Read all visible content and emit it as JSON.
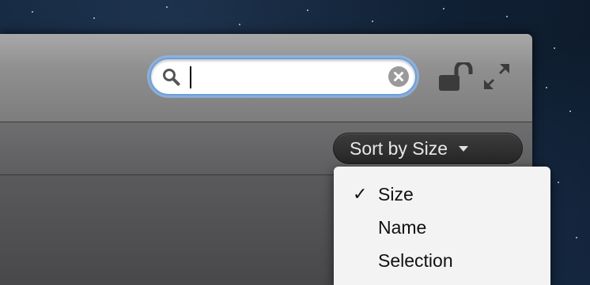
{
  "search": {
    "value": "",
    "placeholder": ""
  },
  "toolbar": {
    "lock_icon": "unlocked-padlock-icon",
    "fullscreen_icon": "fullscreen-arrows-icon"
  },
  "sort": {
    "button_label": "Sort by Size",
    "menu_items": [
      {
        "label": "Size",
        "checked": true,
        "check_glyph": "✓"
      },
      {
        "label": "Name",
        "checked": false,
        "check_glyph": ""
      },
      {
        "label": "Selection",
        "checked": false,
        "check_glyph": ""
      }
    ]
  },
  "colors": {
    "search_focus_ring": "#6f9fd8",
    "toolbar": "#8f8f8f",
    "sort_button": "#2e2e2e",
    "menu_background": "#f3f3f3"
  }
}
